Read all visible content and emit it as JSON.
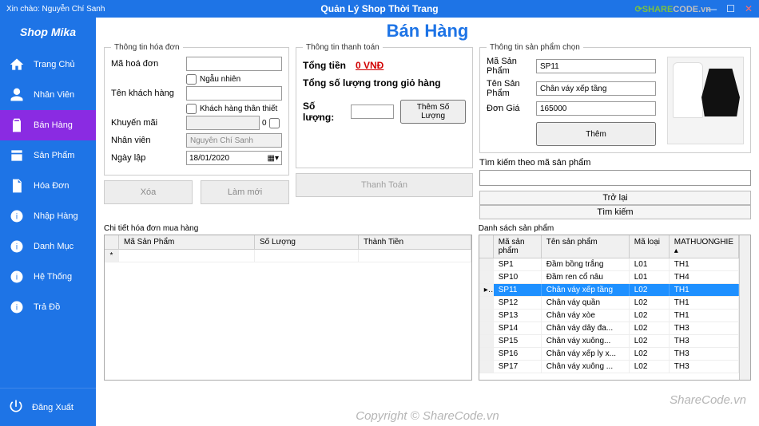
{
  "titlebar": {
    "welcome_prefix": "Xin chào:",
    "welcome_user": "Nguyễn Chí Sanh",
    "app_title": "Quản Lý Shop Thời Trang",
    "logo_a": "SHARE",
    "logo_b": "CODE.vn"
  },
  "sidebar": {
    "brand": "Shop Mika",
    "items": [
      {
        "label": "Trang Chủ"
      },
      {
        "label": "Nhân Viên"
      },
      {
        "label": "Bán Hàng"
      },
      {
        "label": "Sản Phẩm"
      },
      {
        "label": "Hóa Đơn"
      },
      {
        "label": "Nhập Hàng"
      },
      {
        "label": "Danh Mục"
      },
      {
        "label": "Hệ Thống"
      },
      {
        "label": "Trả Đồ"
      }
    ],
    "logout": "Đăng Xuất"
  },
  "page": {
    "title": "Bán Hàng"
  },
  "invoice": {
    "legend": "Thông tin hóa đơn",
    "code_label": "Mã hoá đơn",
    "code_value": "",
    "random_label": "Ngẫu nhiên",
    "customer_label": "Tên khách hàng",
    "customer_value": "",
    "loyal_label": "Khách hàng thân thiết",
    "promo_label": "Khuyến mãi",
    "promo_value": "",
    "promo_side": "0",
    "staff_label": "Nhân viên",
    "staff_value": "Nguyễn Chí Sanh",
    "date_label": "Ngày lập",
    "date_value": "18/01/2020",
    "btn_delete": "Xóa",
    "btn_refresh": "Làm mới"
  },
  "payment": {
    "legend": "Thông tin thanh toán",
    "total_label": "Tổng tiền",
    "total_value": "0 VNĐ",
    "cart_qty_label": "Tổng số lượng trong giỏ hàng",
    "qty_label": "Số lượng:",
    "qty_value": "",
    "btn_add_qty": "Thêm Số Lượng",
    "btn_pay": "Thanh Toán"
  },
  "product_sel": {
    "legend": "Thông tin sản phẩm chọn",
    "code_label": "Mã Sản Phẩm",
    "code_value": "SP11",
    "name_label": "Tên Sản Phẩm",
    "name_value": "Chân váy xếp tầng",
    "price_label": "Đơn Giá",
    "price_value": "165000",
    "btn_add": "Thêm"
  },
  "search": {
    "label": "Tìm kiếm theo mã sản phẩm",
    "value": "",
    "btn_back": "Trở lại",
    "btn_search": "Tìm kiếm"
  },
  "detail_grid": {
    "legend": "Chi tiết hóa đơn mua hàng",
    "cols": [
      "Mã Sản Phẩm",
      "Số Lượng",
      "Thành Tiền"
    ]
  },
  "product_grid": {
    "legend": "Danh sách sản phẩm",
    "cols": [
      "Mã sản phẩm",
      "Tên sản phẩm",
      "Mã loại",
      "MATHUONGHIE"
    ],
    "rows": [
      {
        "c1": "SP1",
        "c2": "Đầm bồng trắng",
        "c3": "L01",
        "c4": "TH1"
      },
      {
        "c1": "SP10",
        "c2": "Đầm ren cổ nâu",
        "c3": "L01",
        "c4": "TH4"
      },
      {
        "c1": "SP11",
        "c2": "Chân váy xếp tầng",
        "c3": "L02",
        "c4": "TH1"
      },
      {
        "c1": "SP12",
        "c2": "Chân váy quần",
        "c3": "L02",
        "c4": "TH1"
      },
      {
        "c1": "SP13",
        "c2": "Chân váy xòe",
        "c3": "L02",
        "c4": "TH1"
      },
      {
        "c1": "SP14",
        "c2": "Chân váy dây đa...",
        "c3": "L02",
        "c4": "TH3"
      },
      {
        "c1": "SP15",
        "c2": "Chân váy xuông...",
        "c3": "L02",
        "c4": "TH3"
      },
      {
        "c1": "SP16",
        "c2": "Chân váy xếp ly x...",
        "c3": "L02",
        "c4": "TH3"
      },
      {
        "c1": "SP17",
        "c2": "Chân váy xuông ...",
        "c3": "L02",
        "c4": "TH3"
      }
    ],
    "selected_index": 2
  },
  "watermarks": {
    "w1": "ShareCode.vn",
    "w2": "Copyright © ShareCode.vn"
  }
}
